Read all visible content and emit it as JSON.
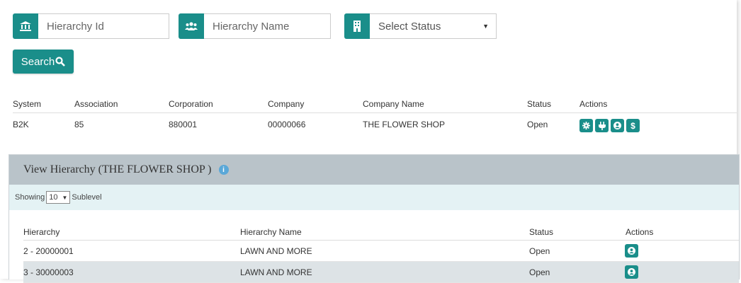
{
  "filters": {
    "hierarchy_id_placeholder": "Hierarchy Id",
    "hierarchy_name_placeholder": "Hierarchy Name",
    "status_selected": "Select Status"
  },
  "search_label": "Search",
  "top_table": {
    "headers": {
      "system": "System",
      "association": "Association",
      "corporation": "Corporation",
      "company": "Company",
      "company_name": "Company Name",
      "status": "Status",
      "actions": "Actions"
    },
    "row": {
      "system": "B2K",
      "association": "85",
      "corporation": "880001",
      "company": "00000066",
      "company_name": "THE FLOWER SHOP",
      "status": "Open"
    }
  },
  "hierarchy_panel": {
    "title": "View Hierarchy (THE FLOWER SHOP )",
    "showing_label": "Showing",
    "page_size": "10",
    "sublevel_label": "Sublevel",
    "headers": {
      "hierarchy": "Hierarchy",
      "hierarchy_name": "Hierarchy Name",
      "status": "Status",
      "actions": "Actions"
    },
    "rows": [
      {
        "hierarchy": "2 - 20000001",
        "hierarchy_name": "LAWN AND MORE",
        "status": "Open"
      },
      {
        "hierarchy": "3 - 30000003",
        "hierarchy_name": "LAWN AND MORE",
        "status": "Open"
      }
    ]
  },
  "colors": {
    "accent": "#1a8e8a",
    "panel_header": "#b9c3c9",
    "panel_subheader": "#e4f2f4",
    "info": "#5aa8d8"
  },
  "icons": {
    "hierarchy_id": "bank-icon",
    "hierarchy_name": "users-icon",
    "status": "building-icon",
    "search": "magnifier-icon",
    "actions": [
      "gear-icon",
      "plug-icon",
      "user-circle-icon",
      "dollar-icon"
    ],
    "row_action": "user-circle-icon"
  }
}
